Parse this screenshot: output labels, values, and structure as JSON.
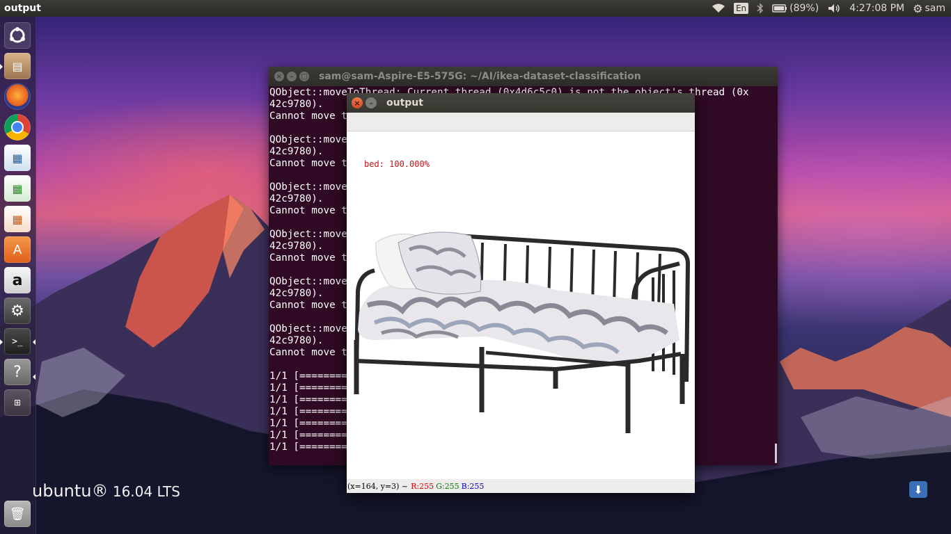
{
  "topbar": {
    "app_title": "output",
    "lang": "En",
    "battery": "(89%)",
    "time": "4:27:08 PM",
    "user": "sam",
    "icons": [
      "wifi-icon",
      "bluetooth-icon",
      "battery-icon",
      "volume-icon",
      "gear-icon"
    ]
  },
  "launcher": {
    "items": [
      "ubuntu-dash",
      "files",
      "firefox",
      "chrome",
      "libreoffice-writer",
      "libreoffice-calc",
      "libreoffice-impress",
      "software-center",
      "amazon",
      "system-settings",
      "terminal",
      "help",
      "workspace-switcher",
      "trash"
    ]
  },
  "watermark": {
    "brand": "ubuntu®",
    "version": " 16.04 LTS"
  },
  "terminal": {
    "title": "sam@sam-Aspire-E5-575G: ~/AI/ikea-dataset-classification",
    "lines": [
      "QObject::moveToThread: Current thread (0x4d6c5c0) is not the object's thread (0x",
      "42c9780).",
      "Cannot move t",
      "",
      "QObject::move                                          s thread (0x",
      "42c9780).",
      "Cannot move t",
      "",
      "QObject::move                                          s thread (0x",
      "42c9780).",
      "Cannot move t",
      "",
      "QObject::move                                          s thread (0x",
      "42c9780).",
      "Cannot move t",
      "",
      "QObject::move                                          s thread (0x",
      "42c9780).",
      "Cannot move t",
      "",
      "QObject::move                                          s thread (0x",
      "42c9780).",
      "Cannot move t",
      "",
      "1/1 [=========",
      "1/1 [=========",
      "1/1 [=========",
      "1/1 [=========",
      "1/1 [=========",
      "1/1 [=========",
      "1/1 [========="
    ]
  },
  "output": {
    "title": "output",
    "prediction": "bed: 100.000%",
    "status": {
      "coords": "(x=164, y=3) ~",
      "r": "R:255",
      "g": "G:255",
      "b": "B:255"
    }
  }
}
